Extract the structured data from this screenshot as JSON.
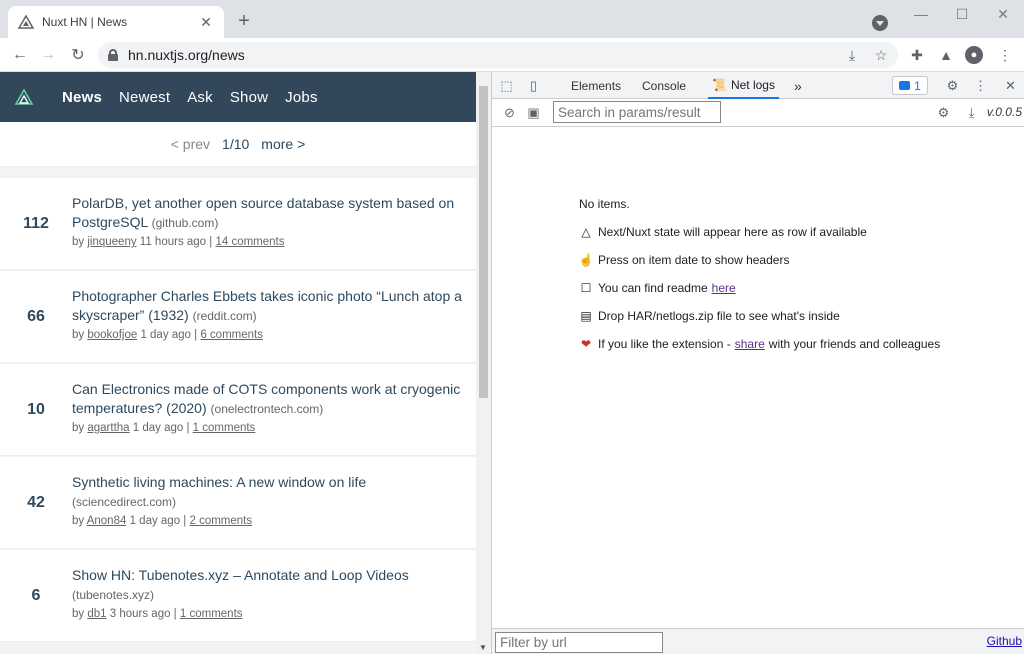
{
  "browser": {
    "tab_title": "Nuxt HN | News",
    "url": "hn.nuxtjs.org/news"
  },
  "hn": {
    "nav": [
      "News",
      "Newest",
      "Ask",
      "Show",
      "Jobs"
    ],
    "pager": {
      "prev": "< prev",
      "page": "1/10",
      "more": "more >"
    },
    "items": [
      {
        "score": "112",
        "title": "PolarDB, yet another open source database system based on PostgreSQL",
        "host": "(github.com)",
        "by": "by",
        "user": "jinqueeny",
        "time": "11 hours ago |",
        "comments": "14 comments"
      },
      {
        "score": "66",
        "title": "Photographer Charles Ebbets takes iconic photo “Lunch atop a skyscraper” (1932)",
        "host": "(reddit.com)",
        "by": "by",
        "user": "bookofjoe",
        "time": "1 day ago |",
        "comments": "6 comments"
      },
      {
        "score": "10",
        "title": "Can Electronics made of COTS components work at cryogenic temperatures? (2020)",
        "host": "(onelectrontech.com)",
        "by": "by",
        "user": "agarttha",
        "time": "1 day ago |",
        "comments": "1 comments"
      },
      {
        "score": "42",
        "title": "Synthetic living machines: A new window on life",
        "host": "(sciencedirect.com)",
        "by": "by",
        "user": "Anon84",
        "time": "1 day ago |",
        "comments": "2 comments"
      },
      {
        "score": "6",
        "title": "Show HN: Tubenotes.xyz – Annotate and Loop Videos",
        "host": "(tubenotes.xyz)",
        "by": "by",
        "user": "db1",
        "time": "3 hours ago |",
        "comments": "1 comments"
      }
    ]
  },
  "devtools": {
    "tabs": {
      "elements": "Elements",
      "console": "Console",
      "netlogs": "Net logs",
      "more": "»"
    },
    "message_count": "1",
    "search_placeholder": "Search in params/result",
    "version": "v.0.0.5",
    "body": {
      "no_items": "No items.",
      "line1": "Next/Nuxt state will appear here as row if available",
      "line2": "Press on item date to show headers",
      "line3_pre": "You can find readme",
      "line3_link": "here",
      "line4": "Drop HAR/netlogs.zip file to see what's inside",
      "line5_pre": "If you like the extension -",
      "line5_link": "share",
      "line5_post": "with your friends and colleagues"
    },
    "filter_placeholder": "Filter by url",
    "github": "Github"
  },
  "colors": {
    "hn_header": "#324759",
    "accent": "#1a73e8"
  }
}
